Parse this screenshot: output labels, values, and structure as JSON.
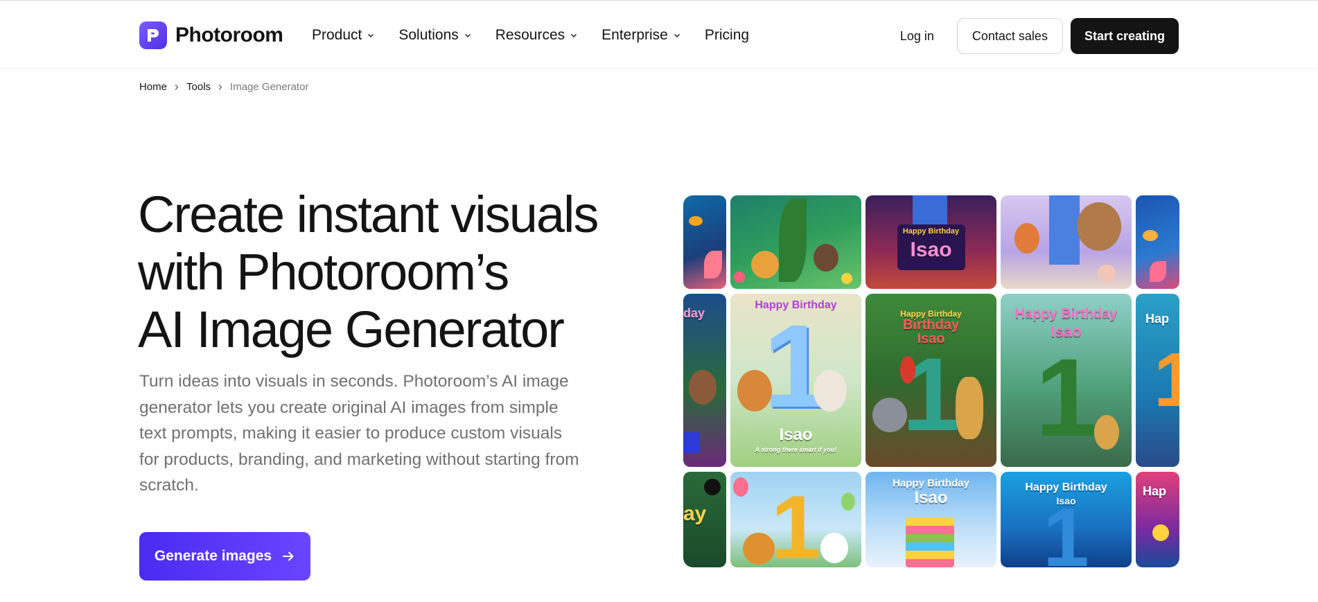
{
  "brand": {
    "name": "Photoroom"
  },
  "nav": {
    "items": [
      {
        "label": "Product",
        "has_menu": true
      },
      {
        "label": "Solutions",
        "has_menu": true
      },
      {
        "label": "Resources",
        "has_menu": true
      },
      {
        "label": "Enterprise",
        "has_menu": true
      },
      {
        "label": "Pricing",
        "has_menu": false
      }
    ]
  },
  "header": {
    "login_label": "Log in",
    "contact_label": "Contact sales",
    "start_label": "Start creating"
  },
  "breadcrumb": {
    "items": [
      "Home",
      "Tools",
      "Image Generator"
    ]
  },
  "hero": {
    "title_line1": "Create instant visuals",
    "title_line2": "with Photoroom’s",
    "title_line3": "AI Image Generator",
    "description": "Turn ideas into visuals in seconds. Photoroom’s AI image generator lets you create original AI images from simple text prompts, making it easier to produce custom visuals for products, branding, and marketing without starting from scratch.",
    "cta_label": "Generate images"
  },
  "gallery": {
    "tile_texts": {
      "happy_birthday": "Happy Birthday",
      "name": "Isao",
      "birthday_word": "Birthday",
      "one": "1",
      "tagline": "A strong there smart if you!",
      "hap": "Hap",
      "day": "day",
      "ay": "ay"
    }
  },
  "colors": {
    "accent": "#5533ff",
    "dark_button": "#141414",
    "muted_text": "#707070"
  }
}
